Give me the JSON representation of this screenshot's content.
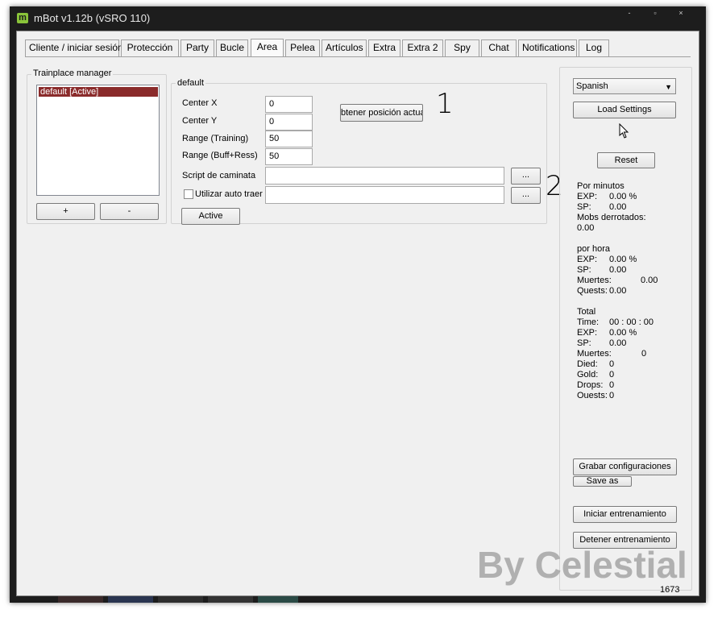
{
  "window": {
    "title": "mBot v1.12b (vSRO 110)",
    "logo": "m",
    "minimize": "-",
    "maximize": "▫",
    "close": "×"
  },
  "tabs": [
    "Cliente / iniciar sesión",
    "Protección",
    "Party",
    "Bucle",
    "Area",
    "Pelea",
    "Artículos",
    "Extra",
    "Extra 2",
    "Spy",
    "Chat",
    "Notifications",
    "Log"
  ],
  "active_tab": "Area",
  "trainplace": {
    "title": "Trainplace manager",
    "items": [
      "default [Active]"
    ],
    "add_label": "+",
    "remove_label": "-"
  },
  "default_group": {
    "title": "default",
    "center_x_label": "Center X",
    "center_x_value": "0",
    "center_y_label": "Center Y",
    "center_y_value": "0",
    "range_training_label": "Range (Training)",
    "range_training_value": "50",
    "range_buff_label": "Range (Buff+Ress)",
    "range_buff_value": "50",
    "get_position_label": "btener posición actua",
    "walk_script_label": "Script de caminata",
    "walk_script_value": "",
    "auto_trace_label": "Utilizar auto traer",
    "auto_trace_value": "",
    "browse_label": "...",
    "active_label": "Active",
    "annotation_1": "1",
    "annotation_2": "2"
  },
  "right_panel": {
    "language": "Spanish",
    "load_settings": "Load Settings",
    "reset": "Reset",
    "per_minute": {
      "heading": "Por minutos",
      "exp_label": "EXP:",
      "exp_value": "0.00 %",
      "sp_label": "SP:",
      "sp_value": "0.00",
      "mobs_label": "Mobs derrotados:",
      "mobs_value": "0.00"
    },
    "per_hour": {
      "heading": "por hora",
      "exp_label": "EXP:",
      "exp_value": "0.00 %",
      "sp_label": "SP:",
      "sp_value": "0.00",
      "deaths_label": "Muertes:",
      "deaths_value": "0.00",
      "quests_label": "Quests:",
      "quests_value": "0.00"
    },
    "total": {
      "heading": "Total",
      "time_label": "Time:",
      "time_value": "00 : 00 : 00",
      "exp_label": "EXP:",
      "exp_value": "0.00 %",
      "sp_label": "SP:",
      "sp_value": "0.00",
      "deaths_label": "Muertes:",
      "deaths_value": "0",
      "died_label": "Died:",
      "died_value": "0",
      "gold_label": "Gold:",
      "gold_value": "0",
      "drops_label": "Drops:",
      "drops_value": "0",
      "quests_label": "Ouests:",
      "quests_value": "0"
    },
    "save_settings": "Grabar configuraciones",
    "save_as": "Save as",
    "start_training": "Iniciar entrenamiento",
    "stop_training": "Detener entrenamiento"
  },
  "status_number": "1673",
  "watermark": "By Celestial",
  "colors": {
    "selection": "#8a2b2b",
    "titlebar": "#1d1d1d",
    "logo": "#8ac43a",
    "watermark": "#a5a5a5"
  }
}
